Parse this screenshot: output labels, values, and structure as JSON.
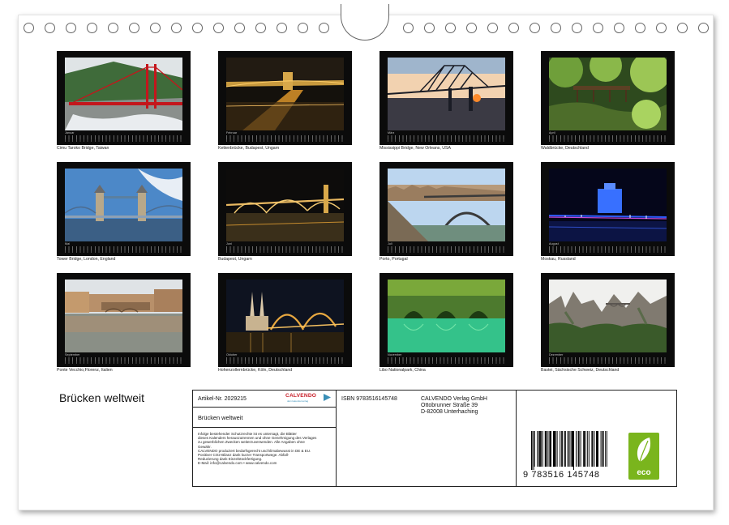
{
  "calendar": {
    "title": "Brücken weltweit",
    "months": [
      {
        "month_label": "Januar",
        "caption": "Cimu Taroko Bridge, Taiwan",
        "scene": "red-suspension"
      },
      {
        "month_label": "Februar",
        "caption": "Kettenbrücke, Budapest, Ungarn",
        "scene": "night-chain"
      },
      {
        "month_label": "März",
        "caption": "Mississippi Bridge, New Orleans, USA",
        "scene": "sunset-truss"
      },
      {
        "month_label": "April",
        "caption": "Waldbrücke, Deutschland",
        "scene": "forest-bridge"
      },
      {
        "month_label": "Mai",
        "caption": "Tower Bridge, London, England",
        "scene": "tower-bridge"
      },
      {
        "month_label": "Juni",
        "caption": "Budapest, Ungarn",
        "scene": "night-arches"
      },
      {
        "month_label": "Juli",
        "caption": "Porto, Portugal",
        "scene": "porto-arch"
      },
      {
        "month_label": "August",
        "caption": "Moskau, Russland",
        "scene": "moscow-night"
      },
      {
        "month_label": "September",
        "caption": "Ponte Vecchio,Florenz, Italien",
        "scene": "ponte-vecchio"
      },
      {
        "month_label": "Oktober",
        "caption": "Hohenzollernbrücke, Köln, Deutschland",
        "scene": "cologne"
      },
      {
        "month_label": "November",
        "caption": "Libo Nationalpark, China",
        "scene": "green-arches"
      },
      {
        "month_label": "Dezember",
        "caption": "Bastei, Sächsische Schweiz, Deutschland",
        "scene": "bastei"
      }
    ]
  },
  "info_box": {
    "article": "Artikel-Nr. 2029215",
    "calvendo_logo": "CALVENDO",
    "calvendo_tagline": "dein kalenderverlag",
    "product_title": "Brücken weltweit",
    "legal_lines": [
      "Infolge bestehender Schutzrechte ist es untersagt, die Blätter",
      "dieses Kalenders herauszutrennen und ohne Genehmigung des Verlages",
      "zu gewerblichen Zwecken weiterzuverwenden. Alle Angaben ohne",
      "Gewähr.",
      "CALVENDO produziert bedarfsgerecht und klimabewusst in DE & EU.",
      "Positiver CO2-Bilanz dank kurzer Transportwege. Abfall-",
      "Reduzierung dank Einzelstückfertigung.",
      "E-Mail: info@calvendo.com • www.calvendo.com"
    ],
    "isbn": "ISBN 9783516145748",
    "publisher_name": "CALVENDO Verlag GmbH",
    "publisher_street": "Ottobrunner Straße 39",
    "publisher_city": "D-82008 Unterhaching",
    "barcode_number": "9 783516 145748",
    "eco_label": "eco"
  },
  "colors": {
    "frame": "#0b0b0b",
    "calvendo_red": "#c8202a",
    "calvendo_blue": "#3a8fb7",
    "eco_green": "#7ab51d"
  }
}
